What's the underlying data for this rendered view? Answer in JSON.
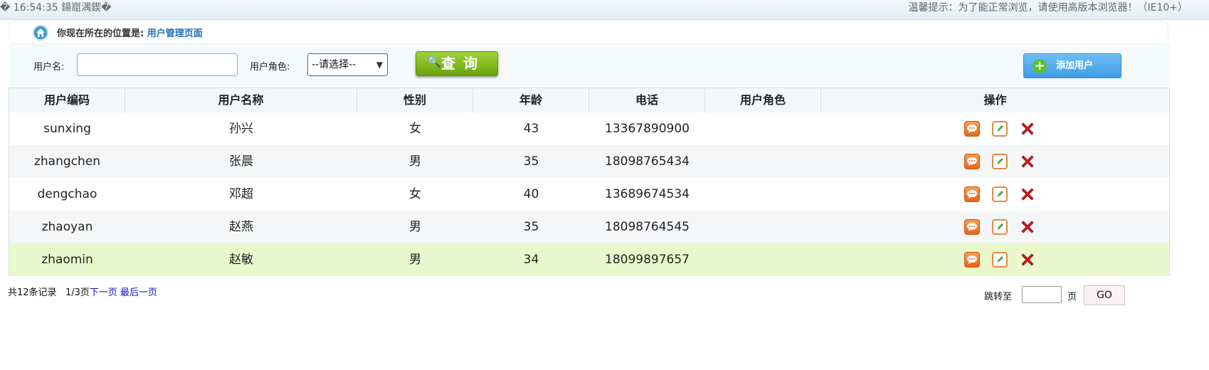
{
  "topbar": {
    "time": "� 16:54:35 鍚崫湡鍥�",
    "tip": "温馨提示：为了能正常浏览，请使用高版本浏览器！（IE10+）"
  },
  "breadcrumb": {
    "prefix": "你现在所在的位置是:",
    "current": "用户管理页面"
  },
  "search": {
    "username_label": "用户名:",
    "username_value": "",
    "role_label": "用户角色:",
    "role_selected": "--请选择--",
    "query_label": "查 询",
    "add_label": "添加用户"
  },
  "table": {
    "headers": [
      "用户编码",
      "用户名称",
      "性别",
      "年龄",
      "电话",
      "用户角色",
      "操作"
    ],
    "rows": [
      {
        "code": "sunxing",
        "name": "孙兴",
        "gender": "女",
        "age": "43",
        "phone": "13367890900",
        "role": ""
      },
      {
        "code": "zhangchen",
        "name": "张晨",
        "gender": "男",
        "age": "35",
        "phone": "18098765434",
        "role": ""
      },
      {
        "code": "dengchao",
        "name": "邓超",
        "gender": "女",
        "age": "40",
        "phone": "13689674534",
        "role": ""
      },
      {
        "code": "zhaoyan",
        "name": "赵燕",
        "gender": "男",
        "age": "35",
        "phone": "18098764545",
        "role": ""
      },
      {
        "code": "zhaomin",
        "name": "赵敏",
        "gender": "男",
        "age": "34",
        "phone": "18099897657",
        "role": ""
      }
    ],
    "row_colors": [
      "#ffffff",
      "#f4f6f8",
      "#ffffff",
      "#f4f6f8",
      "#e9f7cc"
    ]
  },
  "pager": {
    "summary": "共12条记录",
    "page_info": "1/3页",
    "next": "下一页",
    "last": "最后一页",
    "jump_label": "跳转至",
    "page_unit": "页",
    "go": "GO"
  }
}
